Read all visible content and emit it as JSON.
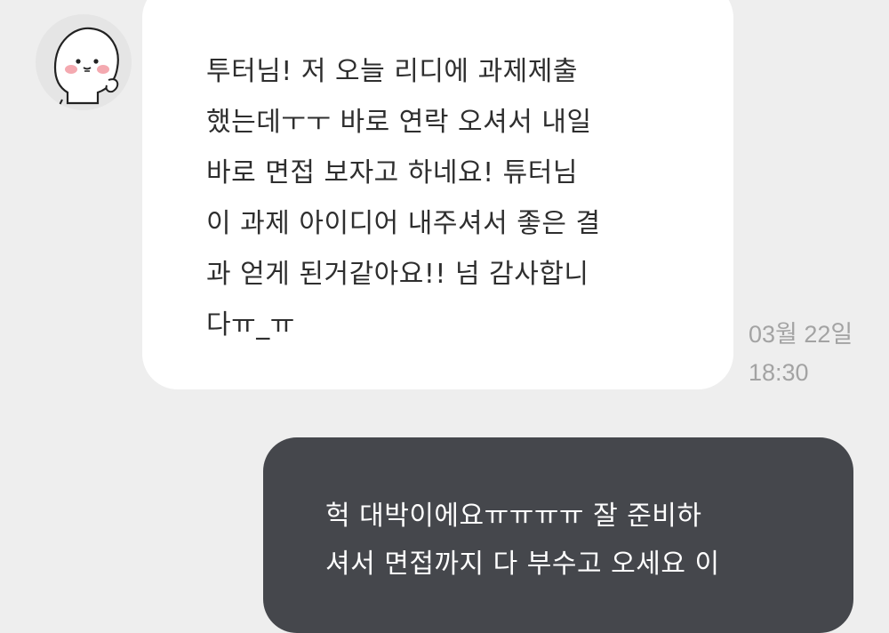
{
  "incoming_message": {
    "lines": [
      "투터님! 저 오늘 리디에 과제제출",
      "했는데ㅜㅜ 바로 연락 오셔서 내일",
      "바로 면접 보자고 하네요! 튜터님",
      "이 과제 아이디어 내주셔서 좋은 결",
      "과 얻게 된거같아요!! 넘 감사합니",
      "다ㅠ_ㅠ"
    ],
    "date": "03월 22일",
    "time": "18:30",
    "avatar_icon": "smiling-blob-character-icon"
  },
  "outgoing_message": {
    "lines": [
      "헉 대박이에요ㅠㅠㅠㅠ 잘 준비하",
      "셔서 면접까지 다 부수고 오세요 이"
    ]
  },
  "colors": {
    "background": "#eeeeee",
    "incoming_bubble": "#ffffff",
    "outgoing_bubble": "#45474c",
    "timestamp": "#a3a3a3"
  }
}
